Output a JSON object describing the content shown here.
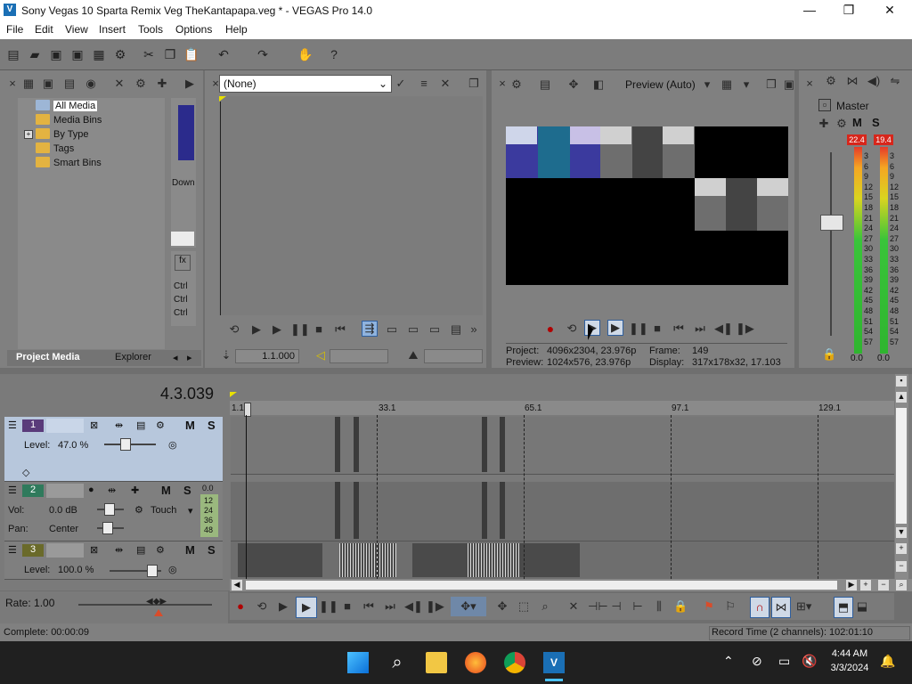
{
  "window": {
    "title": "Sony Vegas 10 Sparta Remix Veg TheKantapapa.veg * - VEGAS Pro 14.0"
  },
  "window_controls": {
    "minimize": "—",
    "maximize": "❐",
    "close": "✕"
  },
  "menu": [
    "File",
    "Edit",
    "View",
    "Insert",
    "Tools",
    "Options",
    "Help"
  ],
  "project_media": {
    "tree": [
      "All Media",
      "Media Bins",
      "By Type",
      "Tags",
      "Smart Bins"
    ],
    "tabs": [
      "Project Media",
      "Explorer"
    ],
    "side_labels": {
      "down": "Down",
      "ctrl": [
        "Ctrl",
        "Ctrl",
        "Ctrl"
      ]
    }
  },
  "trimmer": {
    "dropdown_value": "(None)",
    "time": "1.1.000"
  },
  "preview": {
    "mode": "Preview (Auto)",
    "project_label": "Project:",
    "project_value": "4096x2304, 23.976p",
    "preview_label": "Preview:",
    "preview_value": "1024x576, 23.976p",
    "frame_label": "Frame:",
    "frame_value": "149",
    "display_label": "Display:",
    "display_value": "317x178x32, 17.103"
  },
  "master": {
    "title": "Master",
    "peak_left": "22.4",
    "peak_right": "19.4",
    "scale": [
      "3",
      "6",
      "9",
      "12",
      "15",
      "18",
      "21",
      "24",
      "27",
      "30",
      "33",
      "36",
      "39",
      "42",
      "45",
      "48",
      "51",
      "54",
      "57"
    ],
    "level_left": "0.0",
    "level_right": "0.0",
    "ms": [
      "M",
      "S"
    ]
  },
  "timeline": {
    "time_display": "4.3.039",
    "ruler_marks": [
      "1.1",
      "33.1",
      "65.1",
      "97.1",
      "129.1"
    ],
    "tracks": [
      {
        "number": "1",
        "type": "video",
        "level_label": "Level:",
        "level_value": "47.0 %",
        "m": "M",
        "s": "S"
      },
      {
        "number": "2",
        "type": "audio",
        "vol_label": "Vol:",
        "vol_value": "0.0 dB",
        "pan_label": "Pan:",
        "pan_value": "Center",
        "mode": "Touch",
        "m": "M",
        "s": "S",
        "meter_top": "0.0",
        "meter_marks": [
          "12",
          "24",
          "36",
          "48"
        ]
      },
      {
        "number": "3",
        "type": "video",
        "level_label": "Level:",
        "level_value": "100.0 %",
        "m": "M",
        "s": "S"
      }
    ],
    "rate_label": "Rate: 1.00"
  },
  "status": {
    "complete": "Complete: 00:00:09",
    "record_time": "Record Time (2 channels): 102:01:10"
  },
  "taskbar": {
    "time": "4:44 AM",
    "date": "3/3/2024"
  }
}
